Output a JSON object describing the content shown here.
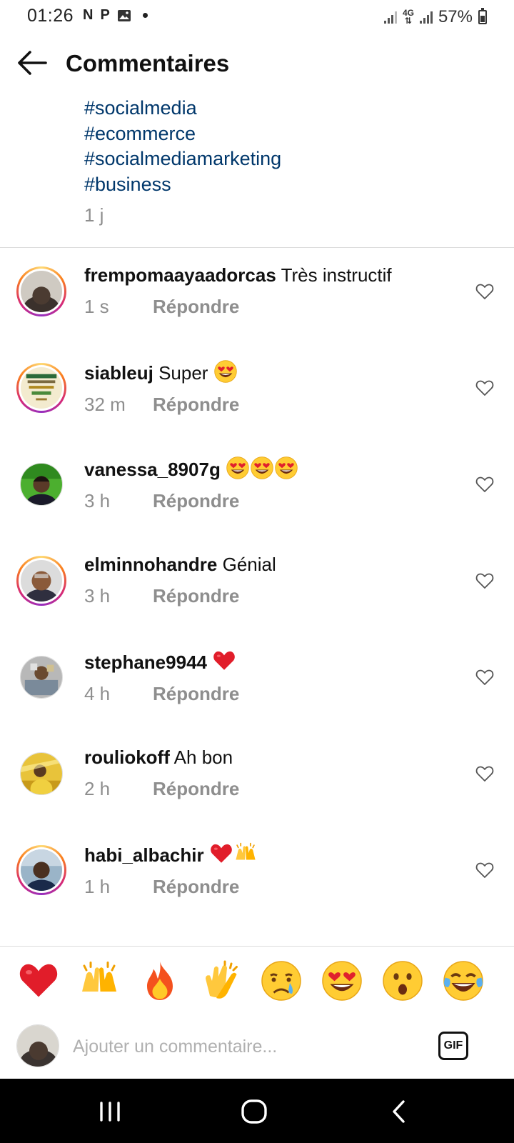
{
  "status_bar": {
    "time": "01:26",
    "notification_icons": [
      "N",
      "P"
    ],
    "network": "4G",
    "battery": "57%"
  },
  "header": {
    "title": "Commentaires"
  },
  "caption": {
    "hashtags": [
      "#socialmedia",
      "#ecommerce",
      "#socialmediamarketing",
      "#business"
    ],
    "time": "1 j"
  },
  "comments": [
    {
      "username": "frempomaayaadorcas",
      "text": "Très instructif",
      "emojis": [],
      "time": "1 s",
      "reply": "Répondre",
      "story_ring": true,
      "avatar": "avatar-1"
    },
    {
      "username": "siableuj",
      "text": "Super",
      "emojis": [
        "heart-eyes"
      ],
      "time": "32 m",
      "reply": "Répondre",
      "story_ring": true,
      "avatar": "avatar-2"
    },
    {
      "username": "vanessa_8907g",
      "text": "",
      "emojis": [
        "heart-eyes",
        "heart-eyes",
        "heart-eyes"
      ],
      "time": "3 h",
      "reply": "Répondre",
      "story_ring": false,
      "avatar": "avatar-3"
    },
    {
      "username": "elminnohandre",
      "text": "Génial",
      "emojis": [],
      "time": "3 h",
      "reply": "Répondre",
      "story_ring": true,
      "avatar": "avatar-4"
    },
    {
      "username": "stephane9944",
      "text": "",
      "emojis": [
        "red-heart"
      ],
      "time": "4 h",
      "reply": "Répondre",
      "story_ring": false,
      "avatar": "avatar-5"
    },
    {
      "username": "rouliokoff",
      "text": "Ah bon",
      "emojis": [],
      "time": "2 h",
      "reply": "Répondre",
      "story_ring": false,
      "avatar": "avatar-6"
    },
    {
      "username": "habi_albachir",
      "text": "",
      "emojis": [
        "red-heart",
        "raised-hands"
      ],
      "time": "1 h",
      "reply": "Répondre",
      "story_ring": true,
      "avatar": "avatar-7"
    }
  ],
  "emoji_bar": [
    "red-heart",
    "raised-hands",
    "fire",
    "clapping-hands",
    "crying-face",
    "heart-eyes",
    "surprised-face",
    "tears-of-joy"
  ],
  "composer": {
    "placeholder": "Ajouter un commentaire...",
    "gif_label": "GIF"
  },
  "colors": {
    "hashtag": "#00376b",
    "muted": "#8e8e8e",
    "divider": "#dbdbdb"
  }
}
